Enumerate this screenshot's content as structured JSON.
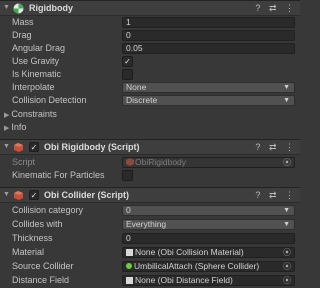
{
  "rigidbody": {
    "title": "Rigidbody",
    "enabled_check": "✓",
    "tools": [
      "?",
      "⇄",
      "⋮"
    ],
    "mass_label": "Mass",
    "mass_value": "1",
    "drag_label": "Drag",
    "drag_value": "0",
    "angular_drag_label": "Angular Drag",
    "angular_drag_value": "0.05",
    "use_gravity_label": "Use Gravity",
    "use_gravity_check": "✓",
    "is_kinematic_label": "Is Kinematic",
    "interpolate_label": "Interpolate",
    "interpolate_value": "None",
    "collision_detection_label": "Collision Detection",
    "collision_detection_value": "Discrete",
    "constraints_label": "Constraints",
    "info_label": "Info"
  },
  "obi_rigidbody": {
    "title": "Obi Rigidbody (Script)",
    "enabled_check": "✓",
    "tools": [
      "?",
      "⇄",
      "⋮"
    ],
    "script_label": "Script",
    "script_value": "ObiRigidbody",
    "kinematic_label": "Kinematic For Particles"
  },
  "obi_collider": {
    "title": "Obi Collider (Script)",
    "enabled_check": "✓",
    "tools": [
      "?",
      "⇄",
      "⋮"
    ],
    "collision_category_label": "Collision category",
    "collision_category_value": "0",
    "collides_with_label": "Collides with",
    "collides_with_value": "Everything",
    "thickness_label": "Thickness",
    "thickness_value": "0",
    "material_label": "Material",
    "material_value": "None (Obi Collision Material)",
    "source_collider_label": "Source Collider",
    "source_collider_value": "UmbilicalAttach (Sphere Collider)",
    "distance_field_label": "Distance Field",
    "distance_field_value": "None (Obi Distance Field)"
  },
  "icons": {
    "fold_open": "▼",
    "fold_closed": "▶",
    "dropdown_caret": "▼",
    "object_picker": "⦿"
  },
  "colors": {
    "panel_bg": "#383838",
    "header_bg": "#3e3e3e",
    "field_bg": "#2a2a2a",
    "dropdown_bg": "#515151",
    "source_dot": "#6ecb3e"
  }
}
